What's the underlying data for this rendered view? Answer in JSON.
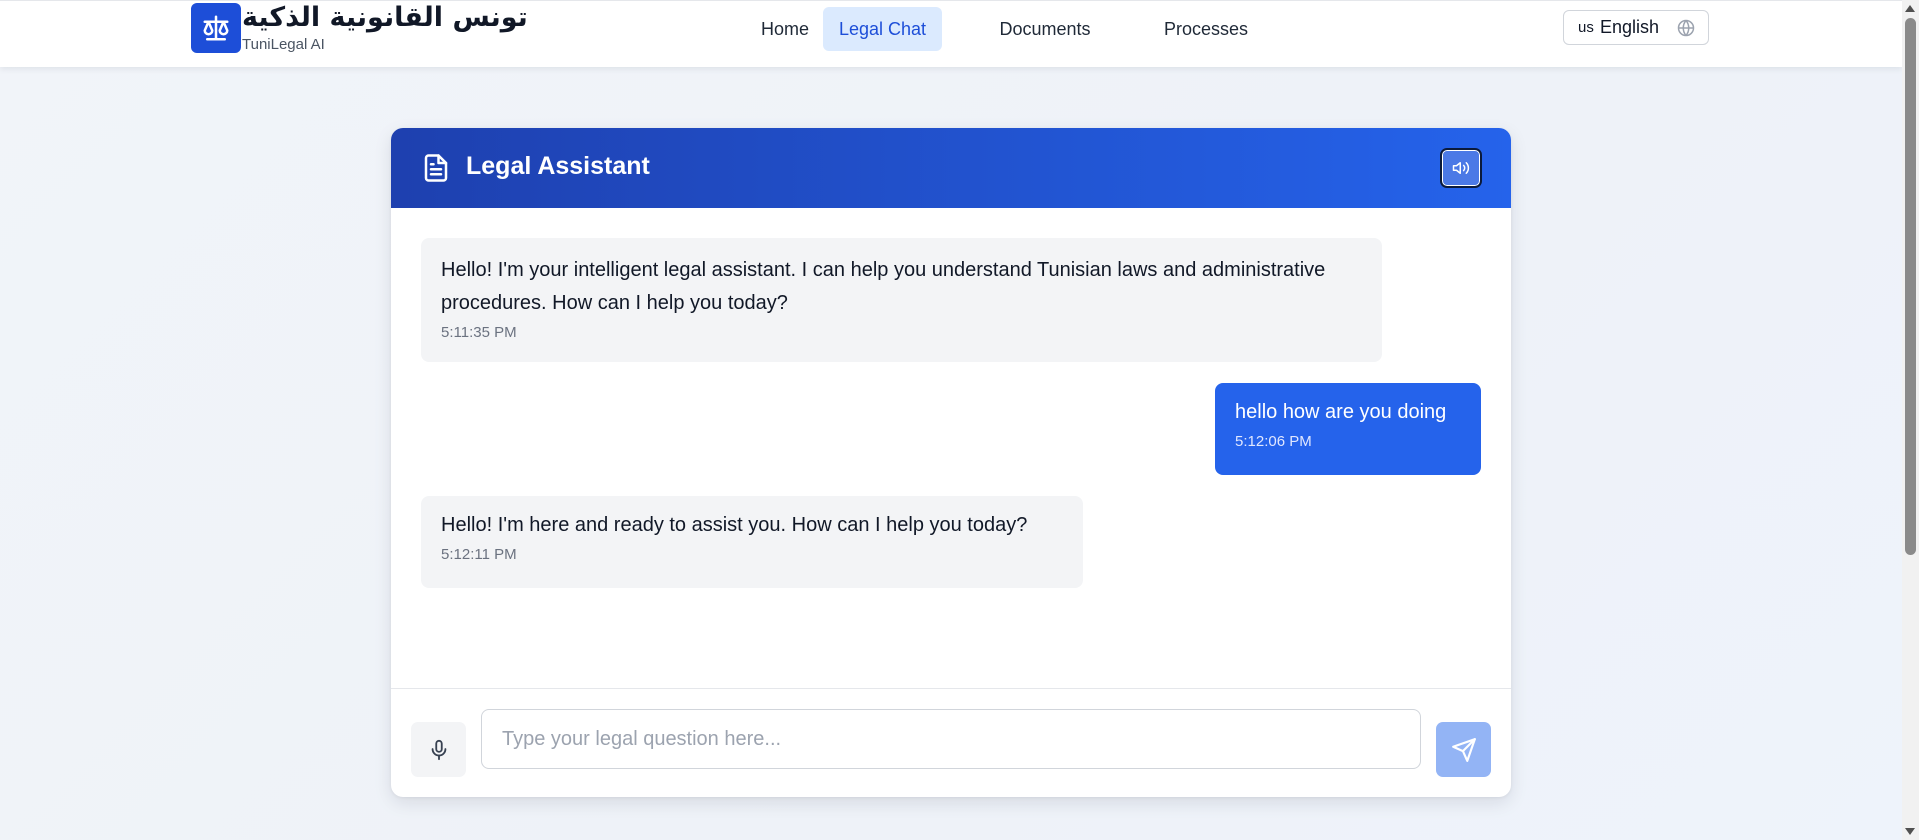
{
  "header": {
    "brand_title": "تونس القانونية الذكية",
    "brand_subtitle": "TuniLegal AI",
    "nav": [
      {
        "label": "Home"
      },
      {
        "label": "Legal Chat"
      },
      {
        "label": "Documents"
      },
      {
        "label": "Processes"
      }
    ],
    "active_nav": "Legal Chat",
    "language": {
      "flag": "us",
      "label": "English"
    }
  },
  "chat": {
    "title": "Legal Assistant",
    "messages": [
      {
        "role": "assistant",
        "text": "Hello! I'm your intelligent legal assistant. I can help you understand Tunisian laws and administrative procedures. How can I help you today?",
        "time": "5:11:35 PM"
      },
      {
        "role": "user",
        "text": "hello how are you doing",
        "time": "5:12:06 PM"
      },
      {
        "role": "assistant",
        "text": "Hello! I'm here and ready to assist you. How can I help you today?",
        "time": "5:12:11 PM"
      }
    ],
    "input": {
      "value": "",
      "placeholder": "Type your legal question here..."
    }
  },
  "colors": {
    "primary": "#2563eb",
    "header_gradient_start": "#1e40af",
    "bot_bubble": "#f3f4f6",
    "active_nav_bg": "#dbeafe"
  },
  "icons": {
    "logo": "scale-icon",
    "card_header": "document-icon",
    "speaker": "speaker-icon",
    "mic": "microphone-icon",
    "send": "send-icon",
    "language": "globe-icon"
  }
}
